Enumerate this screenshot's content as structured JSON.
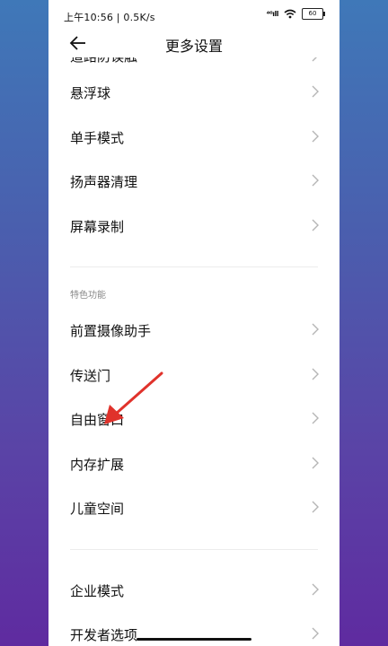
{
  "status_bar": {
    "time_speed": "上午10:56 | 0.5K/s",
    "signal": "⁴ᴳıll",
    "battery": "60"
  },
  "header": {
    "title": "更多设置"
  },
  "partial_item": {
    "label": "道路防误触"
  },
  "group1": [
    {
      "label": "悬浮球"
    },
    {
      "label": "单手模式"
    },
    {
      "label": "扬声器清理"
    },
    {
      "label": "屏幕录制"
    }
  ],
  "section_feature": {
    "label": "特色功能"
  },
  "group2": [
    {
      "label": "前置摄像助手"
    },
    {
      "label": "传送门"
    },
    {
      "label": "自由窗口"
    },
    {
      "label": "内存扩展"
    },
    {
      "label": "儿童空间"
    }
  ],
  "group3": [
    {
      "label": "企业模式"
    },
    {
      "label": "开发者选项"
    }
  ],
  "icons": {
    "back": "arrow-left-icon",
    "chevron": "chevron-right-icon",
    "wifi": "wifi-icon",
    "battery": "battery-icon"
  },
  "colors": {
    "annotation_arrow": "#e0322b",
    "background_top": "#3f78b8",
    "background_bottom": "#5f2ba0"
  }
}
